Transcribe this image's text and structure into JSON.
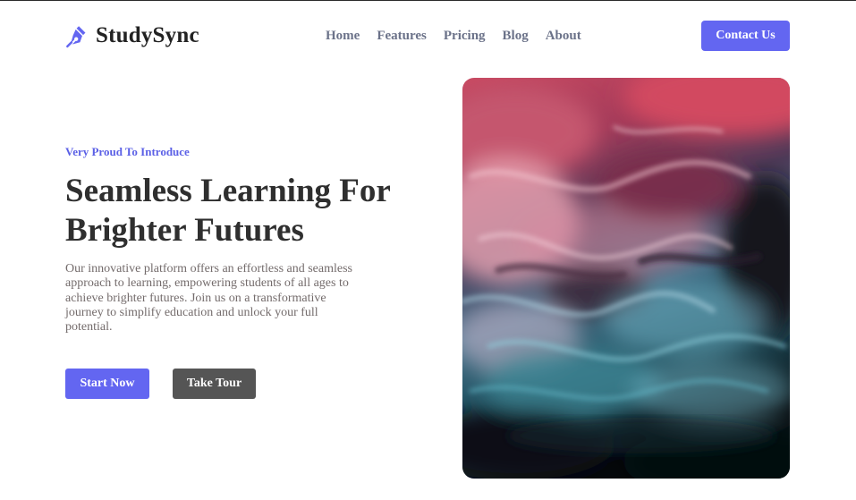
{
  "brand": {
    "name": "StudySync",
    "icon": "pen-nib-icon",
    "accent": "#6366f1"
  },
  "nav": {
    "links": [
      "Home",
      "Features",
      "Pricing",
      "Blog",
      "About"
    ],
    "contact_label": "Contact Us"
  },
  "hero": {
    "eyebrow": "Very Proud To Introduce",
    "title_line1": "Seamless Learning For",
    "title_line2": "Brighter Futures",
    "description": "Our innovative platform offers an effortless and seamless approach to learning, empowering students of all ages to achieve brighter futures. Join us on a transformative journey to simplify education and unlock your full potential.",
    "primary_button": "Start Now",
    "secondary_button": "Take Tour",
    "secondary_color": "#555555"
  }
}
